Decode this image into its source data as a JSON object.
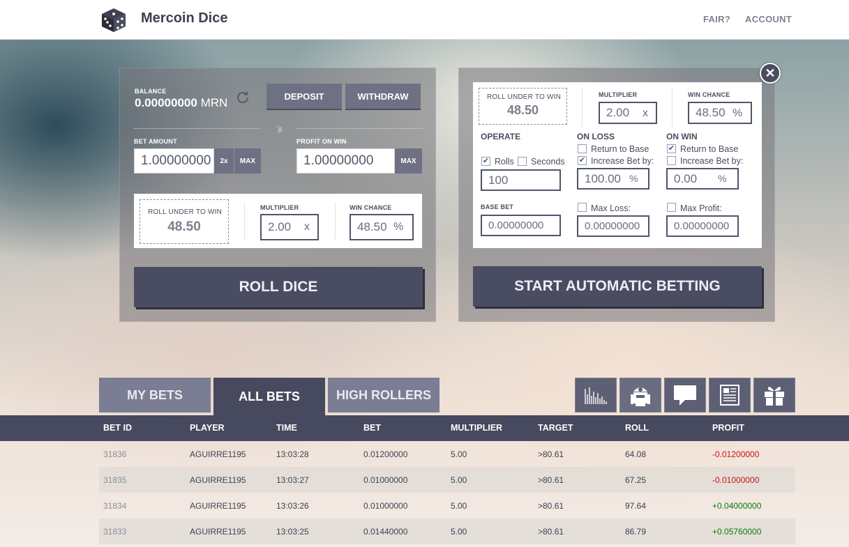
{
  "header": {
    "brand": "Mercoin Dice",
    "nav": [
      "FAIR?",
      "ACCOUNT"
    ]
  },
  "manual": {
    "balance_label": "BALANCE",
    "balance_value": "0.00000000",
    "balance_unit": "MRN",
    "deposit": "DEPOSIT",
    "withdraw": "WITHDRAW",
    "bet_amount_label": "BET AMOUNT",
    "bet_amount_value": "1.00000000",
    "double": "2x",
    "max": "MAX",
    "profit_label": "PROFIT ON WIN",
    "profit_value": "1.00000000",
    "profit_max": "MAX",
    "roll_under_label": "ROLL UNDER TO WIN",
    "roll_under_value": "48.50",
    "multiplier_label": "MULTIPLIER",
    "multiplier_value": "2.00",
    "multiplier_unit": "x",
    "win_chance_label": "WIN CHANCE",
    "win_chance_value": "48.50",
    "win_chance_unit": "%",
    "roll_button": "ROLL DICE"
  },
  "auto": {
    "roll_under_label": "ROLL UNDER TO WIN",
    "roll_under_value": "48.50",
    "multiplier_label": "MULTIPLIER",
    "multiplier_value": "2.00",
    "multiplier_unit": "x",
    "win_chance_label": "WIN CHANCE",
    "win_chance_value": "48.50",
    "win_chance_unit": "%",
    "operate_label": "OPERATE",
    "rolls_label": "Rolls",
    "seconds_label": "Seconds",
    "operate_value": "100",
    "on_loss_label": "ON LOSS",
    "loss_return": "Return to Base",
    "loss_increase": "Increase Bet by:",
    "loss_increase_value": "100.00",
    "loss_unit": "%",
    "on_win_label": "ON WIN",
    "win_return": "Return to Base",
    "win_increase": "Increase Bet by:",
    "win_increase_value": "0.00",
    "win_unit": "%",
    "base_bet_label": "BASE BET",
    "base_bet_value": "0.00000000",
    "max_loss_label": "Max Loss:",
    "max_loss_value": "0.00000000",
    "max_profit_label": "Max Profit:",
    "max_profit_value": "0.00000000",
    "start_button": "START AUTOMATIC BETTING"
  },
  "tabs": [
    "MY BETS",
    "ALL BETS",
    "HIGH ROLLERS"
  ],
  "icons": [
    "stats-chart-icon",
    "robot-icon",
    "chat-icon",
    "news-icon",
    "gift-icon"
  ],
  "table": {
    "headers": [
      "BET ID",
      "PLAYER",
      "TIME",
      "BET",
      "MULTIPLIER",
      "TARGET",
      "ROLL",
      "PROFIT"
    ],
    "rows": [
      [
        "31836",
        "AGUIRRE1195",
        "13:03:28",
        "0.01200000",
        "5.00",
        ">80.61",
        "64.08",
        "-0.01200000"
      ],
      [
        "31835",
        "AGUIRRE1195",
        "13:03:27",
        "0.01000000",
        "5.00",
        ">80.61",
        "67.25",
        "-0.01000000"
      ],
      [
        "31834",
        "AGUIRRE1195",
        "13:03:26",
        "0.01000000",
        "5.00",
        ">80.61",
        "97.64",
        "+0.04000000"
      ],
      [
        "31833",
        "AGUIRRE1195",
        "13:03:25",
        "0.01440000",
        "5.00",
        ">80.61",
        "86.79",
        "+0.05760000"
      ]
    ]
  },
  "colors": {
    "slate_dark": "#474a5e",
    "slate_btn": "#6e7183",
    "loss": "#d0101a",
    "win": "#0a7a0a"
  }
}
